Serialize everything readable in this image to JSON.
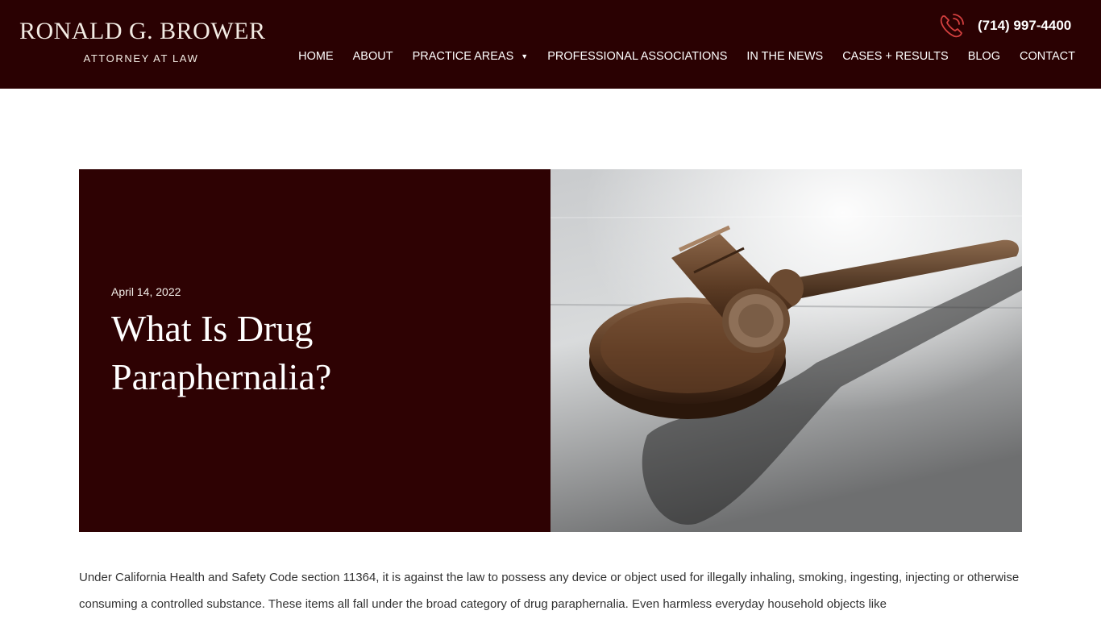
{
  "header": {
    "logo_name": "RONALD G. BROWER",
    "logo_subtitle": "ATTORNEY AT LAW",
    "phone": "(714) 997-4400",
    "icons": {
      "phone": "phone-ringing-icon",
      "caret": "caret-down-icon"
    }
  },
  "nav": {
    "items": [
      {
        "label": "HOME"
      },
      {
        "label": "ABOUT"
      },
      {
        "label": "PRACTICE AREAS"
      },
      {
        "label": "PROFESSIONAL ASSOCIATIONS"
      },
      {
        "label": "IN THE NEWS"
      },
      {
        "label": "CASES + RESULTS"
      },
      {
        "label": "BLOG"
      },
      {
        "label": "CONTACT"
      }
    ]
  },
  "post": {
    "date": "April 14, 2022",
    "title": "What Is Drug Paraphernalia?",
    "image_subject": "wooden gavel on sound block",
    "body": "Under California Health and Safety Code section 11364, it is against the law to possess any device or object used for illegally inhaling, smoking, ingesting, injecting or otherwise consuming a controlled substance. These items all fall under the broad category of drug paraphernalia. Even harmless everyday household objects like"
  },
  "colors": {
    "header_bg": "#2a0102",
    "hero_panel_bg": "#2e0203",
    "phone_icon": "#d5403f",
    "text": "#333333"
  }
}
